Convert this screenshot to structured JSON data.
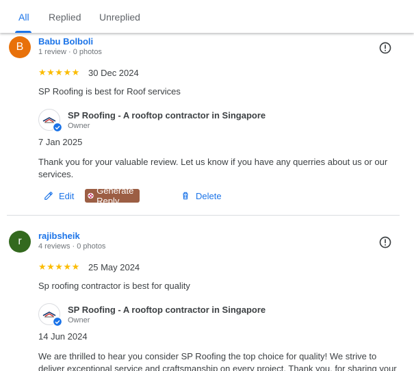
{
  "tabs": [
    {
      "label": "All",
      "active": true
    },
    {
      "label": "Replied",
      "active": false
    },
    {
      "label": "Unreplied",
      "active": false
    }
  ],
  "reviews": [
    {
      "avatar_letter": "B",
      "avatar_color": "#e8710a",
      "author": "Babu Bolboli",
      "meta": "1 review · 0 photos",
      "stars": "★★★★★",
      "date": "30 Dec 2024",
      "text": "SP Roofing is best for Roof services",
      "reply": {
        "business": "SP Roofing - A rooftop contractor in Singapore",
        "role": "Owner",
        "date": "7 Jan 2025",
        "text": "Thank you for your valuable review. Let us know if you have any querries about us or our services."
      },
      "actions": {
        "edit": "Edit",
        "generate": "Generate Reply",
        "delete": "Delete"
      }
    },
    {
      "avatar_letter": "r",
      "avatar_color": "#33691e",
      "author": "rajibsheik",
      "meta": "4 reviews · 0 photos",
      "stars": "★★★★★",
      "date": "25 May 2024",
      "text": "Sp roofing contractor is best for quality",
      "reply": {
        "business": "SP Roofing - A rooftop contractor in Singapore",
        "role": "Owner",
        "date": "14 Jun 2024",
        "text": "We are thrilled to hear you consider SP Roofing the top choice for quality! We strive to deliver exceptional service and craftsmanship on every project. Thank you, for sharing your"
      }
    }
  ],
  "colors": {
    "accent": "#1a73e8",
    "star": "#fbbc04",
    "generate_button": "#9c5e44",
    "verified": "#1a73e8"
  },
  "icons": {
    "flag": "report-icon",
    "edit": "pencil-icon",
    "generate": "flower-icon",
    "delete": "trash-icon",
    "verified": "verified-check-icon"
  }
}
